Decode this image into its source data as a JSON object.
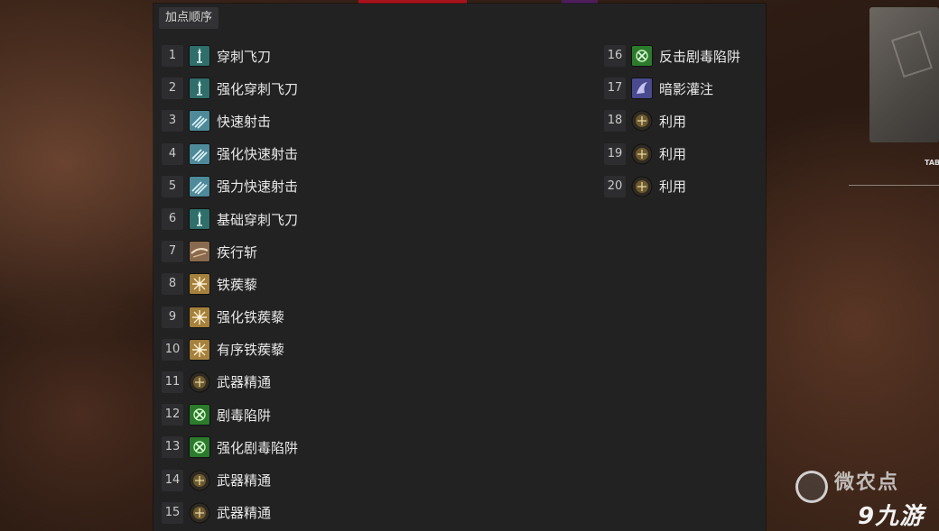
{
  "panel": {
    "title": "加点顺序",
    "left_column": [
      {
        "num": "1",
        "label": "穿刺飞刀",
        "icon": "piercing-knife-icon"
      },
      {
        "num": "2",
        "label": "强化穿刺飞刀",
        "icon": "piercing-knife-icon"
      },
      {
        "num": "3",
        "label": "快速射击",
        "icon": "rapid-fire-icon"
      },
      {
        "num": "4",
        "label": "强化快速射击",
        "icon": "rapid-fire-icon"
      },
      {
        "num": "5",
        "label": "强力快速射击",
        "icon": "rapid-fire-icon"
      },
      {
        "num": "6",
        "label": "基础穿刺飞刀",
        "icon": "piercing-knife-icon"
      },
      {
        "num": "7",
        "label": "疾行斩",
        "icon": "dash-slash-icon"
      },
      {
        "num": "8",
        "label": "铁蒺藜",
        "icon": "caltrops-icon"
      },
      {
        "num": "9",
        "label": "强化铁蒺藜",
        "icon": "caltrops-icon"
      },
      {
        "num": "10",
        "label": "有序铁蒺藜",
        "icon": "caltrops-icon"
      },
      {
        "num": "11",
        "label": "武器精通",
        "icon": "passive-node-icon"
      },
      {
        "num": "12",
        "label": "剧毒陷阱",
        "icon": "poison-trap-icon"
      },
      {
        "num": "13",
        "label": "强化剧毒陷阱",
        "icon": "poison-trap-icon"
      },
      {
        "num": "14",
        "label": "武器精通",
        "icon": "passive-node-icon"
      },
      {
        "num": "15",
        "label": "武器精通",
        "icon": "passive-node-icon"
      }
    ],
    "right_column": [
      {
        "num": "16",
        "label": "反击剧毒陷阱",
        "icon": "poison-trap-icon"
      },
      {
        "num": "17",
        "label": "暗影灌注",
        "icon": "shadow-imbuement-icon"
      },
      {
        "num": "18",
        "label": "利用",
        "icon": "passive-node-icon"
      },
      {
        "num": "19",
        "label": "利用",
        "icon": "passive-node-icon"
      },
      {
        "num": "20",
        "label": "利用",
        "icon": "passive-node-icon"
      }
    ]
  },
  "background": {
    "watermark_text": "微农点",
    "logo_text": "9九游",
    "tag_text": "TAB"
  },
  "colors": {
    "panel_bg": "#222223",
    "badge_bg": "#2d2d2f",
    "text": "#e8e8e8",
    "knife_icon": "#2f6e6a",
    "rapid_icon": "#4e8a9a",
    "dash_icon": "#8a6a4e",
    "caltrops_icon": "#a5813d",
    "poison_icon": "#2c7a2c",
    "shadow_icon": "#4a4a8e",
    "passive_icon": "#6e5a2e"
  }
}
